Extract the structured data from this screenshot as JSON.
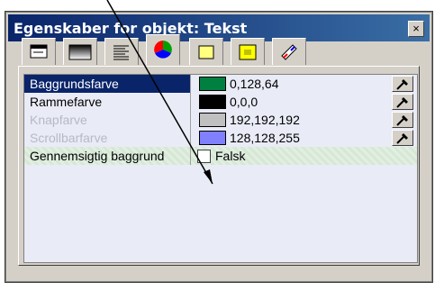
{
  "window": {
    "title": "Egenskaber for objekt: Tekst",
    "close_glyph": "×"
  },
  "tabs": [
    {
      "name": "properties-icon"
    },
    {
      "name": "gradient-icon"
    },
    {
      "name": "align-icon"
    },
    {
      "name": "color-wheel-icon"
    },
    {
      "name": "yellow-box-icon"
    },
    {
      "name": "yellow-frame-icon"
    },
    {
      "name": "paint-icon"
    }
  ],
  "properties": [
    {
      "label": "Baggrundsfarve",
      "value": "0,128,64",
      "color": "#008040"
    },
    {
      "label": "Rammefarve",
      "value": "0,0,0",
      "color": "#000000"
    },
    {
      "label": "Knapfarve",
      "value": "192,192,192",
      "color": "#c0c0c0"
    },
    {
      "label": "Scrollbarfarve",
      "value": "128,128,255",
      "color": "#8080ff"
    },
    {
      "label": "Gennemsigtig baggrund",
      "value": "Falsk"
    }
  ]
}
